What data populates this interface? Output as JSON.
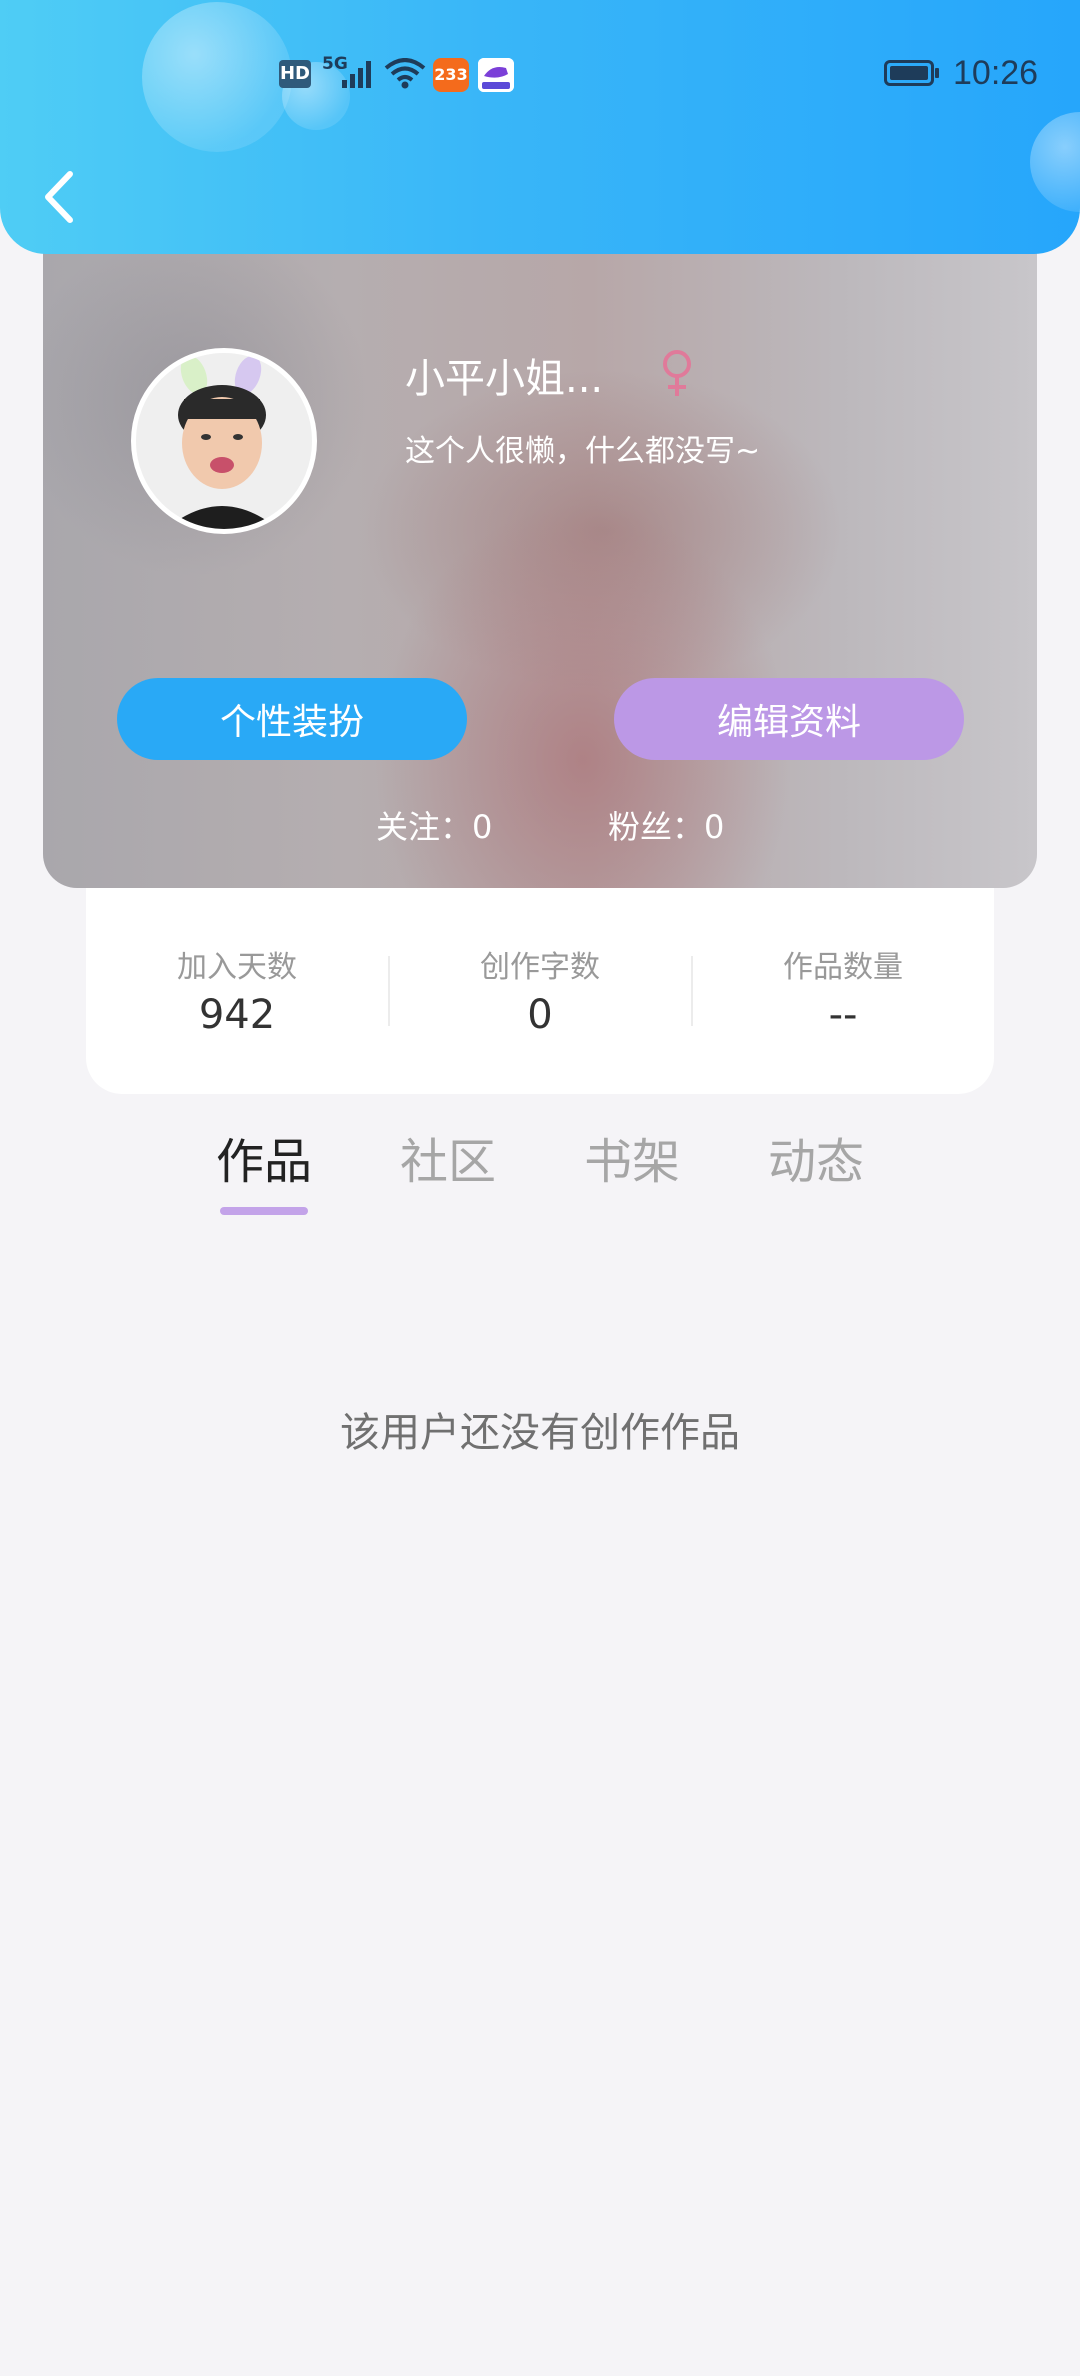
{
  "status_bar": {
    "hd": "HD",
    "network": "5G",
    "badge_233": "233",
    "time": "10:26"
  },
  "profile": {
    "name": "小平小姐...",
    "gender": "female",
    "bio": "这个人很懒，什么都没写~",
    "dressup_label": "个性装扮",
    "edit_label": "编辑资料",
    "following": "关注：0",
    "fans": "粉丝：0"
  },
  "stats": [
    {
      "label": "加入天数",
      "value": "942"
    },
    {
      "label": "创作字数",
      "value": "0"
    },
    {
      "label": "作品数量",
      "value": "--"
    }
  ],
  "tabs": [
    {
      "label": "作品",
      "active": true
    },
    {
      "label": "社区",
      "active": false
    },
    {
      "label": "书架",
      "active": false
    },
    {
      "label": "动态",
      "active": false
    }
  ],
  "empty_message": "该用户还没有创作作品",
  "colors": {
    "header_gradient_start": "#4fcdf5",
    "header_gradient_end": "#26a6fb",
    "dressup_button": "#29a9f6",
    "edit_button": "#bc98e6",
    "tab_indicator": "#c3a3e9",
    "gender_icon": "#e07a9a"
  },
  "icons": {
    "back": "back-arrow-icon",
    "gender": "female-icon"
  }
}
